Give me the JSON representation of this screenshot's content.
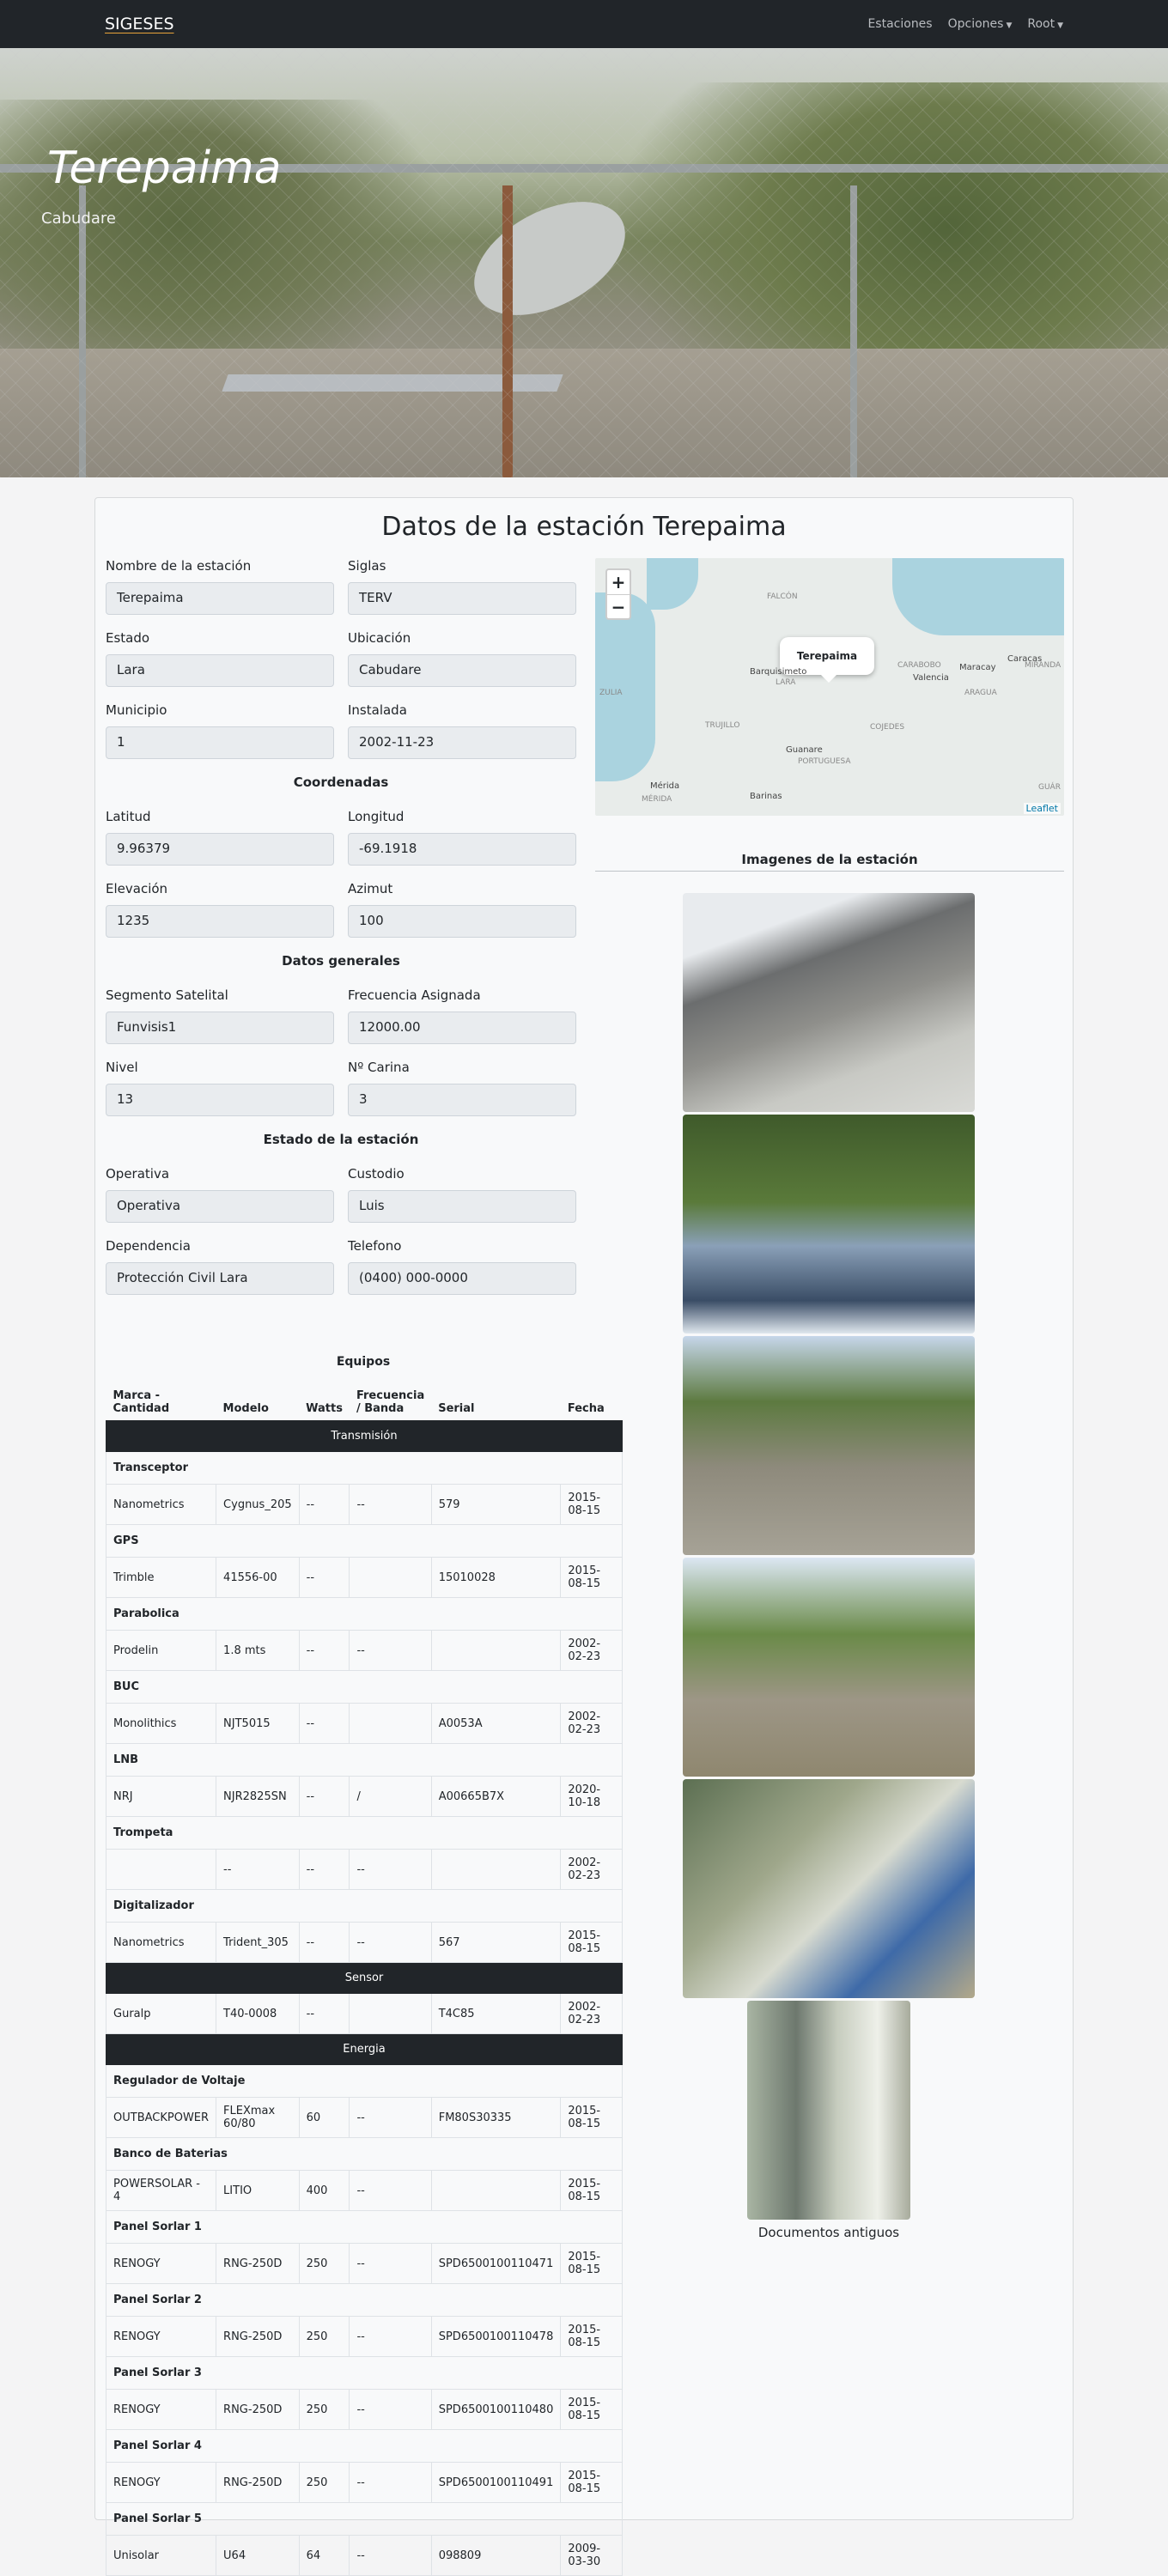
{
  "navbar": {
    "brand": "SIGESES",
    "links": [
      "Estaciones",
      "Opciones",
      "Root"
    ]
  },
  "hero": {
    "title": "Terepaima",
    "subtitle": "Cabudare"
  },
  "card": {
    "title": "Datos de la estación Terepaima"
  },
  "form": {
    "nombre": {
      "label": "Nombre de la estación",
      "value": "Terepaima"
    },
    "siglas": {
      "label": "Siglas",
      "value": "TERV"
    },
    "estado": {
      "label": "Estado",
      "value": "Lara"
    },
    "ubicacion": {
      "label": "Ubicación",
      "value": "Cabudare"
    },
    "municipio": {
      "label": "Municipio",
      "value": "1"
    },
    "instalada": {
      "label": "Instalada",
      "value": "2002-11-23"
    },
    "coordenadas_title": "Coordenadas",
    "latitud": {
      "label": "Latitud",
      "value": "9.96379"
    },
    "longitud": {
      "label": "Longitud",
      "value": "-69.1918"
    },
    "elevacion": {
      "label": "Elevación",
      "value": "1235"
    },
    "azimut": {
      "label": "Azimut",
      "value": "100"
    },
    "generales_title": "Datos generales",
    "segmento": {
      "label": "Segmento Satelital",
      "value": "Funvisis1"
    },
    "frecuencia": {
      "label": "Frecuencia Asignada",
      "value": "12000.00"
    },
    "nivel": {
      "label": "Nivel",
      "value": "13"
    },
    "carina": {
      "label": "Nº Carina",
      "value": "3"
    },
    "estado_title": "Estado de la estación",
    "operativa": {
      "label": "Operativa",
      "value": "Operativa"
    },
    "custodio": {
      "label": "Custodio",
      "value": "Luis"
    },
    "dependencia": {
      "label": "Dependencia",
      "value": "Protección Civil Lara"
    },
    "telefono": {
      "label": "Telefono",
      "value": "(0400) 000-0000"
    }
  },
  "map": {
    "zoom_in": "+",
    "zoom_out": "−",
    "popup": "Terepaima",
    "places": [
      "FALCÓN",
      "Barquisimeto",
      "LARA",
      "CARABOBO",
      "Maracay",
      "Caracas",
      "Valencia",
      "MIRANDA",
      "ARAGUA",
      "ZULIA",
      "TRUJILLO",
      "COJEDES",
      "Guanare",
      "PORTUGUESA",
      "Mérida",
      "Barinas",
      "MÉRIDA",
      "GUÁR"
    ],
    "attribution": "Leaflet"
  },
  "images": {
    "heading": "Imagenes de la estación",
    "documents": "Documentos antiguos"
  },
  "equipos": {
    "title": "Equipos",
    "headers": [
      "Marca - Cantidad",
      "Modelo",
      "Watts",
      "Frecuencia / Banda",
      "Serial",
      "Fecha"
    ],
    "sections": [
      {
        "name": "Transmisión",
        "groups": [
          {
            "name": "Transceptor",
            "rows": [
              [
                "Nanometrics",
                "Cygnus_205",
                "--",
                "--",
                "579",
                "2015-08-15"
              ]
            ]
          },
          {
            "name": "GPS",
            "rows": [
              [
                "Trimble",
                "41556-00",
                "--",
                "",
                "15010028",
                "2015-08-15"
              ]
            ]
          },
          {
            "name": "Parabolica",
            "rows": [
              [
                "Prodelin",
                "1.8 mts",
                "--",
                "--",
                "",
                "2002-02-23"
              ]
            ]
          },
          {
            "name": "BUC",
            "rows": [
              [
                "Monolithics",
                "NJT5015",
                "--",
                "",
                "A0053A",
                "2002-02-23"
              ]
            ]
          },
          {
            "name": "LNB",
            "rows": [
              [
                "NRJ",
                "NJR2825SN",
                "--",
                "/",
                "A00665B7X",
                "2020-10-18"
              ]
            ]
          },
          {
            "name": "Trompeta",
            "rows": [
              [
                "",
                "--",
                "--",
                "--",
                "",
                "2002-02-23"
              ]
            ]
          },
          {
            "name": "Digitalizador",
            "rows": [
              [
                "Nanometrics",
                "Trident_305",
                "--",
                "--",
                "567",
                "2015-08-15"
              ]
            ]
          }
        ]
      },
      {
        "name": "Sensor",
        "groups": [
          {
            "name": "",
            "rows": [
              [
                "Guralp",
                "T40-0008",
                "--",
                "",
                "T4C85",
                "2002-02-23"
              ]
            ]
          }
        ]
      },
      {
        "name": "Energia",
        "groups": [
          {
            "name": "Regulador de Voltaje",
            "rows": [
              [
                "OUTBACKPOWER",
                "FLEXmax 60/80",
                "60",
                "--",
                "FM80S30335",
                "2015-08-15"
              ]
            ]
          },
          {
            "name": "Banco de Baterias",
            "rows": [
              [
                "POWERSOLAR - 4",
                "LITIO",
                "400",
                "--",
                "",
                "2015-08-15"
              ]
            ]
          },
          {
            "name": "Panel Sorlar 1",
            "rows": [
              [
                "RENOGY",
                "RNG-250D",
                "250",
                "--",
                "SPD6500100110471",
                "2015-08-15"
              ]
            ]
          },
          {
            "name": "Panel Sorlar 2",
            "rows": [
              [
                "RENOGY",
                "RNG-250D",
                "250",
                "--",
                "SPD6500100110478",
                "2015-08-15"
              ]
            ]
          },
          {
            "name": "Panel Sorlar 3",
            "rows": [
              [
                "RENOGY",
                "RNG-250D",
                "250",
                "--",
                "SPD6500100110480",
                "2015-08-15"
              ]
            ]
          },
          {
            "name": "Panel Sorlar 4",
            "rows": [
              [
                "RENOGY",
                "RNG-250D",
                "250",
                "--",
                "SPD6500100110491",
                "2015-08-15"
              ]
            ]
          },
          {
            "name": "Panel Sorlar 5",
            "rows": [
              [
                "Unisolar",
                "U64",
                "64",
                "--",
                "098809",
                "2009-03-30"
              ]
            ]
          }
        ]
      }
    ]
  }
}
